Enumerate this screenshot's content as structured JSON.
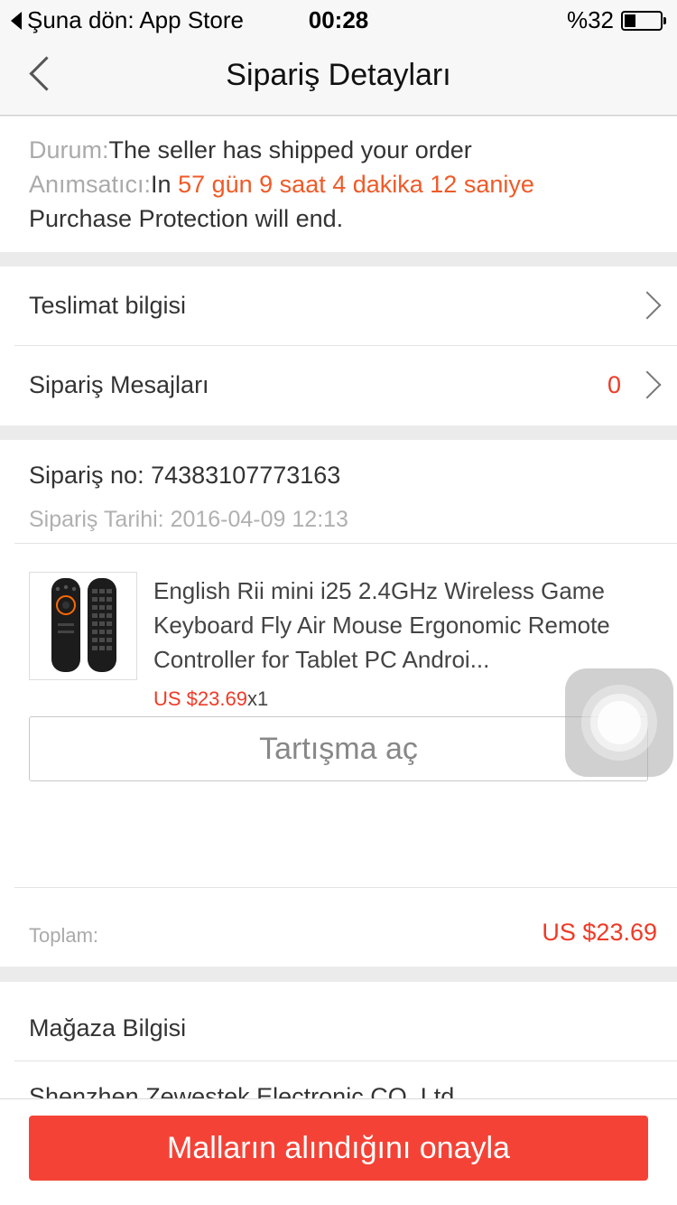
{
  "status_bar": {
    "back_app": "Şuna dön: App Store",
    "time": "00:28",
    "battery": "%32",
    "battery_level": 0.32
  },
  "nav": {
    "title": "Sipariş Detayları"
  },
  "order_status": {
    "status_label": "Durum:",
    "status_value": "The seller has shipped your order",
    "reminder_label": "Anımsatıcı:",
    "reminder_prefix": "In ",
    "countdown": "57 gün 9 saat 4 dakika 12 saniye",
    "reminder_suffix": "Purchase Protection will end."
  },
  "rows": {
    "delivery_label": "Teslimat bilgisi",
    "messages_label": "Sipariş Mesajları",
    "messages_count": "0"
  },
  "order": {
    "number_label": "Sipariş no:",
    "number_value": "74383107773163",
    "date_label": "Sipariş Tarihi:",
    "date_value": "2016-04-09 12:13",
    "product_title": "English Rii mini i25 2.4GHz Wireless Game Keyboard Fly Air Mouse Ergonomic Remote Controller for Tablet PC Androi...",
    "product_price": "US $23.69",
    "product_qty": "x1",
    "dispute_button": "Tartışma aç",
    "total_label": "Toplam:",
    "total_value": "US $23.69"
  },
  "store": {
    "title": "Mağaza Bilgisi",
    "name": "Shenzhen Zewestek Electronic CO.,Ltd"
  },
  "bottom": {
    "confirm_button": "Malların alındığını onayla"
  },
  "colors": {
    "accent_orange": "#ef5a28",
    "price_red": "#ef3a26",
    "button_red": "#f44336"
  }
}
